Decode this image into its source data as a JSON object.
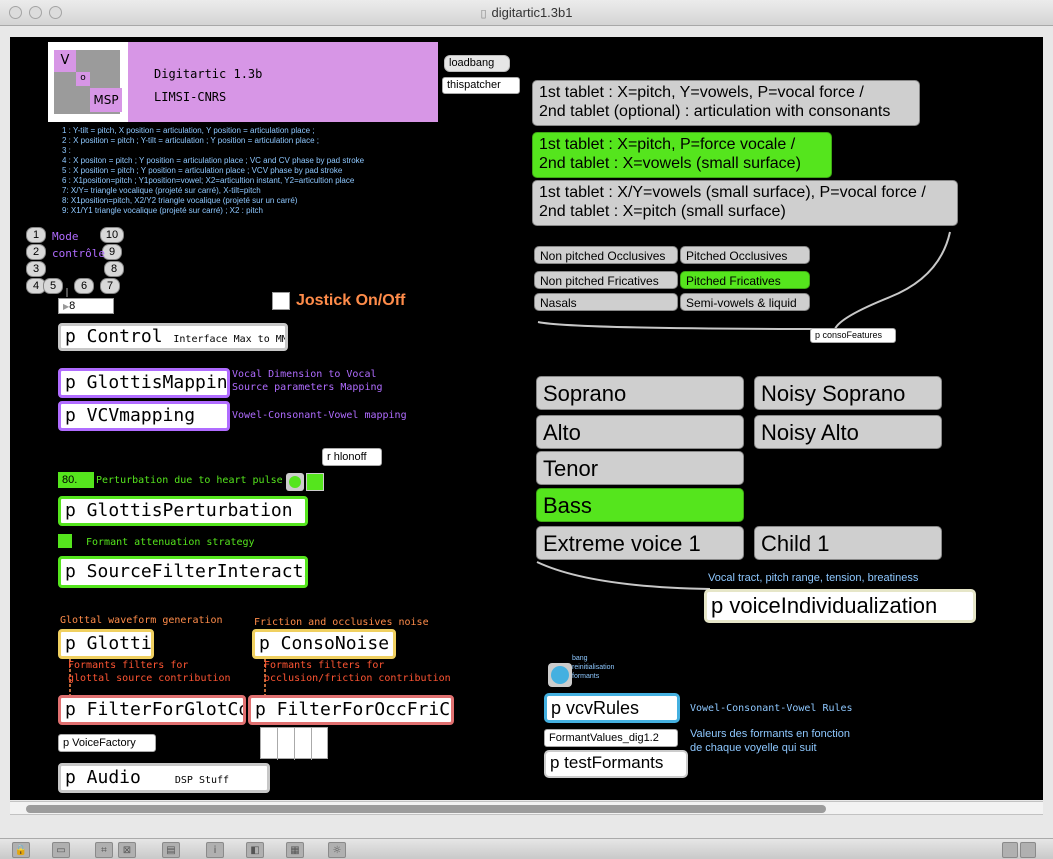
{
  "window": {
    "title": "digitartic1.3b1"
  },
  "header": {
    "logo_v": "V",
    "logo_o": "o",
    "logo_msp": "MSP",
    "app_name": "Digitartic 1.3b",
    "org": "LIMSI-CNRS",
    "loadbang": "loadbang",
    "thispatcher": "thispatcher"
  },
  "modes_comment": [
    "1 : Y-tilt = pitch, X position = articulation, Y position = articulation place ;",
    "2 : X position = pitch ; Y-tilt = articulation ; Y position = articulation place ;",
    "3 :",
    "4 : X positon = pitch ; Y position = articulation place ; VC and CV phase by pad stroke",
    "5 : X position = pitch ; Y position = articulation place ; VCV phase by pad stroke",
    "6 : X1position=pitch ; Y1position=vowel; X2=articultion instant, Y2=articultion place",
    "7: X/Y= triangle vocalique (projeté sur carré), X-tilt=pitch",
    "8: X1position=pitch, X2/Y2 triangle vocalique (projeté sur un carré)",
    "9: X1/Y1 triangle vocalique (projeté sur carré) ; X2 : pitch"
  ],
  "mode_buttons": [
    "1",
    "2",
    "3",
    "4",
    "5",
    "6",
    "7",
    "8",
    "9",
    "10"
  ],
  "mode_label": "Mode",
  "mode_label2": "contrôle",
  "mode_number": "8",
  "jostick_label": "Jostick On/Off",
  "control": {
    "name": "p Control",
    "comment": "Interface Max to MM"
  },
  "glottis_mapping": {
    "name": "p GlottisMapping",
    "comment1": "Vocal Dimension to Vocal",
    "comment2": "Source parameters Mapping"
  },
  "vcv_mapping": {
    "name": "p VCVmapping",
    "comment": "Vowel-Consonant-Vowel mapping"
  },
  "r_hlonoff": "r hlonoff",
  "pulse_number": "80.",
  "perturbation_comment": "Perturbation due to heart pulse",
  "glottis_perturbation": "p GlottisPerturbation",
  "formant_attenuation": "Formant attenuation strategy",
  "source_filter": "p SourceFilterInteraction",
  "glottal_waveform": "Glottal waveform generation",
  "glottis": "p Glottis",
  "friction_comment": "Friction and occlusives noise",
  "conso_noise": "p ConsoNoise",
  "formants_glot1": "Formants filters for",
  "formants_glot2": "glottal source contribution",
  "formants_occ1": "Formants filters for",
  "formants_occ2": "occlusion/friction contribution",
  "filter_glot": "p FilterForGlotCont",
  "filter_occ": "p FilterForOccFriCon",
  "voice_factory": "p VoiceFactory",
  "audio": {
    "name": "p Audio",
    "comment": "DSP Stuff"
  },
  "tablets": [
    {
      "line1": "1st tablet : X=pitch, Y=vowels, P=vocal force /",
      "line2": "2nd tablet (optional) : articulation with consonants",
      "active": false
    },
    {
      "line1": "1st tablet : X=pitch, P=force vocale /",
      "line2": "2nd tablet : X=vowels (small surface)",
      "active": true
    },
    {
      "line1": "1st tablet : X/Y=vowels (small surface), P=vocal force /",
      "line2": "2nd tablet : X=pitch (small surface)",
      "active": false
    }
  ],
  "features": [
    {
      "label": "Non pitched Occlusives",
      "active": false
    },
    {
      "label": "Pitched Occlusives",
      "active": false
    },
    {
      "label": "Non pitched Fricatives",
      "active": false
    },
    {
      "label": "Pitched Fricatives",
      "active": true
    },
    {
      "label": "Nasals",
      "active": false
    },
    {
      "label": "Semi-vowels & liquid",
      "active": false
    }
  ],
  "conso_features": "p consoFeatures",
  "voices": [
    {
      "label": "Soprano",
      "active": false
    },
    {
      "label": "Noisy Soprano",
      "active": false
    },
    {
      "label": "Alto",
      "active": false
    },
    {
      "label": "Noisy Alto",
      "active": false
    },
    {
      "label": "Tenor",
      "active": false
    },
    {
      "label": "Bass",
      "active": true
    },
    {
      "label": "Extreme voice 1",
      "active": false
    },
    {
      "label": "Child 1",
      "active": false
    }
  ],
  "vocal_tract_comment": "Vocal tract, pitch range, tension, breatiness",
  "voice_individualization": "p voiceIndividualization",
  "bang_comment1": "bang",
  "bang_comment2": "reinitialisation",
  "bang_comment3": "formants",
  "vcv_rules": "p vcvRules",
  "vcv_rules_comment": "Vowel-Consonant-Vowel Rules",
  "formant_values": "FormantValues_dig1.2",
  "formant_values_comment1": "Valeurs des formants en fonction",
  "formant_values_comment2": "de chaque voyelle qui suit",
  "test_formants": "p testFormants",
  "colors": {
    "green": "#55e51d",
    "purple": "#d796e6",
    "orange": "#ff8c4a"
  }
}
